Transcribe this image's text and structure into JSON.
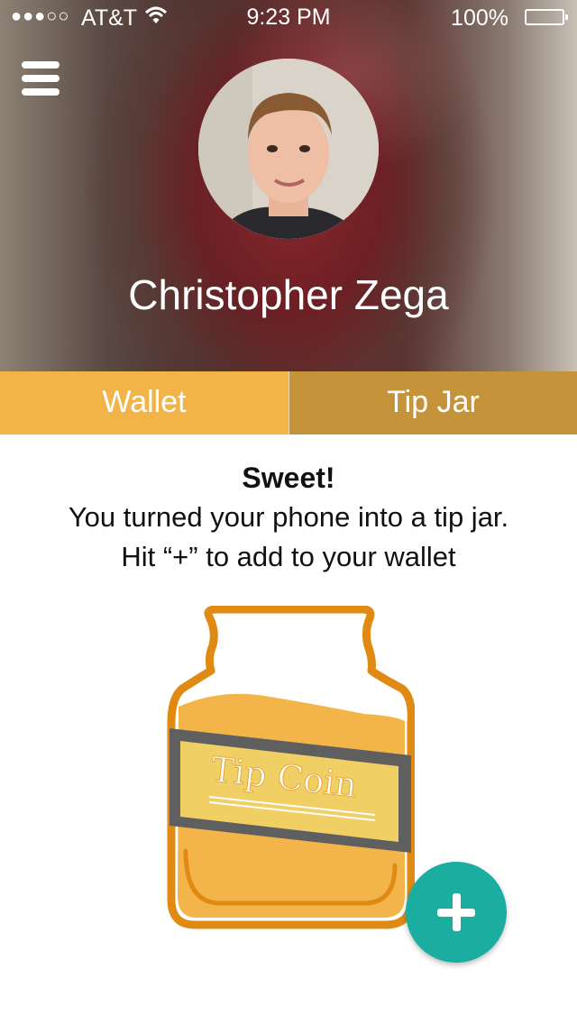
{
  "status_bar": {
    "signal": "●●●○○",
    "carrier": "AT&T",
    "time": "9:23 PM",
    "battery": "100%"
  },
  "profile": {
    "name": "Christopher Zega"
  },
  "tabs": [
    {
      "label": "Wallet",
      "active": true
    },
    {
      "label": "Tip Jar",
      "active": false
    }
  ],
  "message": {
    "title": "Sweet!",
    "line1": "You turned your phone into a tip jar.",
    "line2": "Hit “+” to add to your wallet"
  },
  "jar": {
    "label": "Tip Coin"
  },
  "colors": {
    "wallet_tab": "#f2b448",
    "tipjar_tab": "#c5943a",
    "fab": "#1aada0",
    "jar_outline": "#e08a14",
    "jar_fill": "#f3b54a"
  }
}
